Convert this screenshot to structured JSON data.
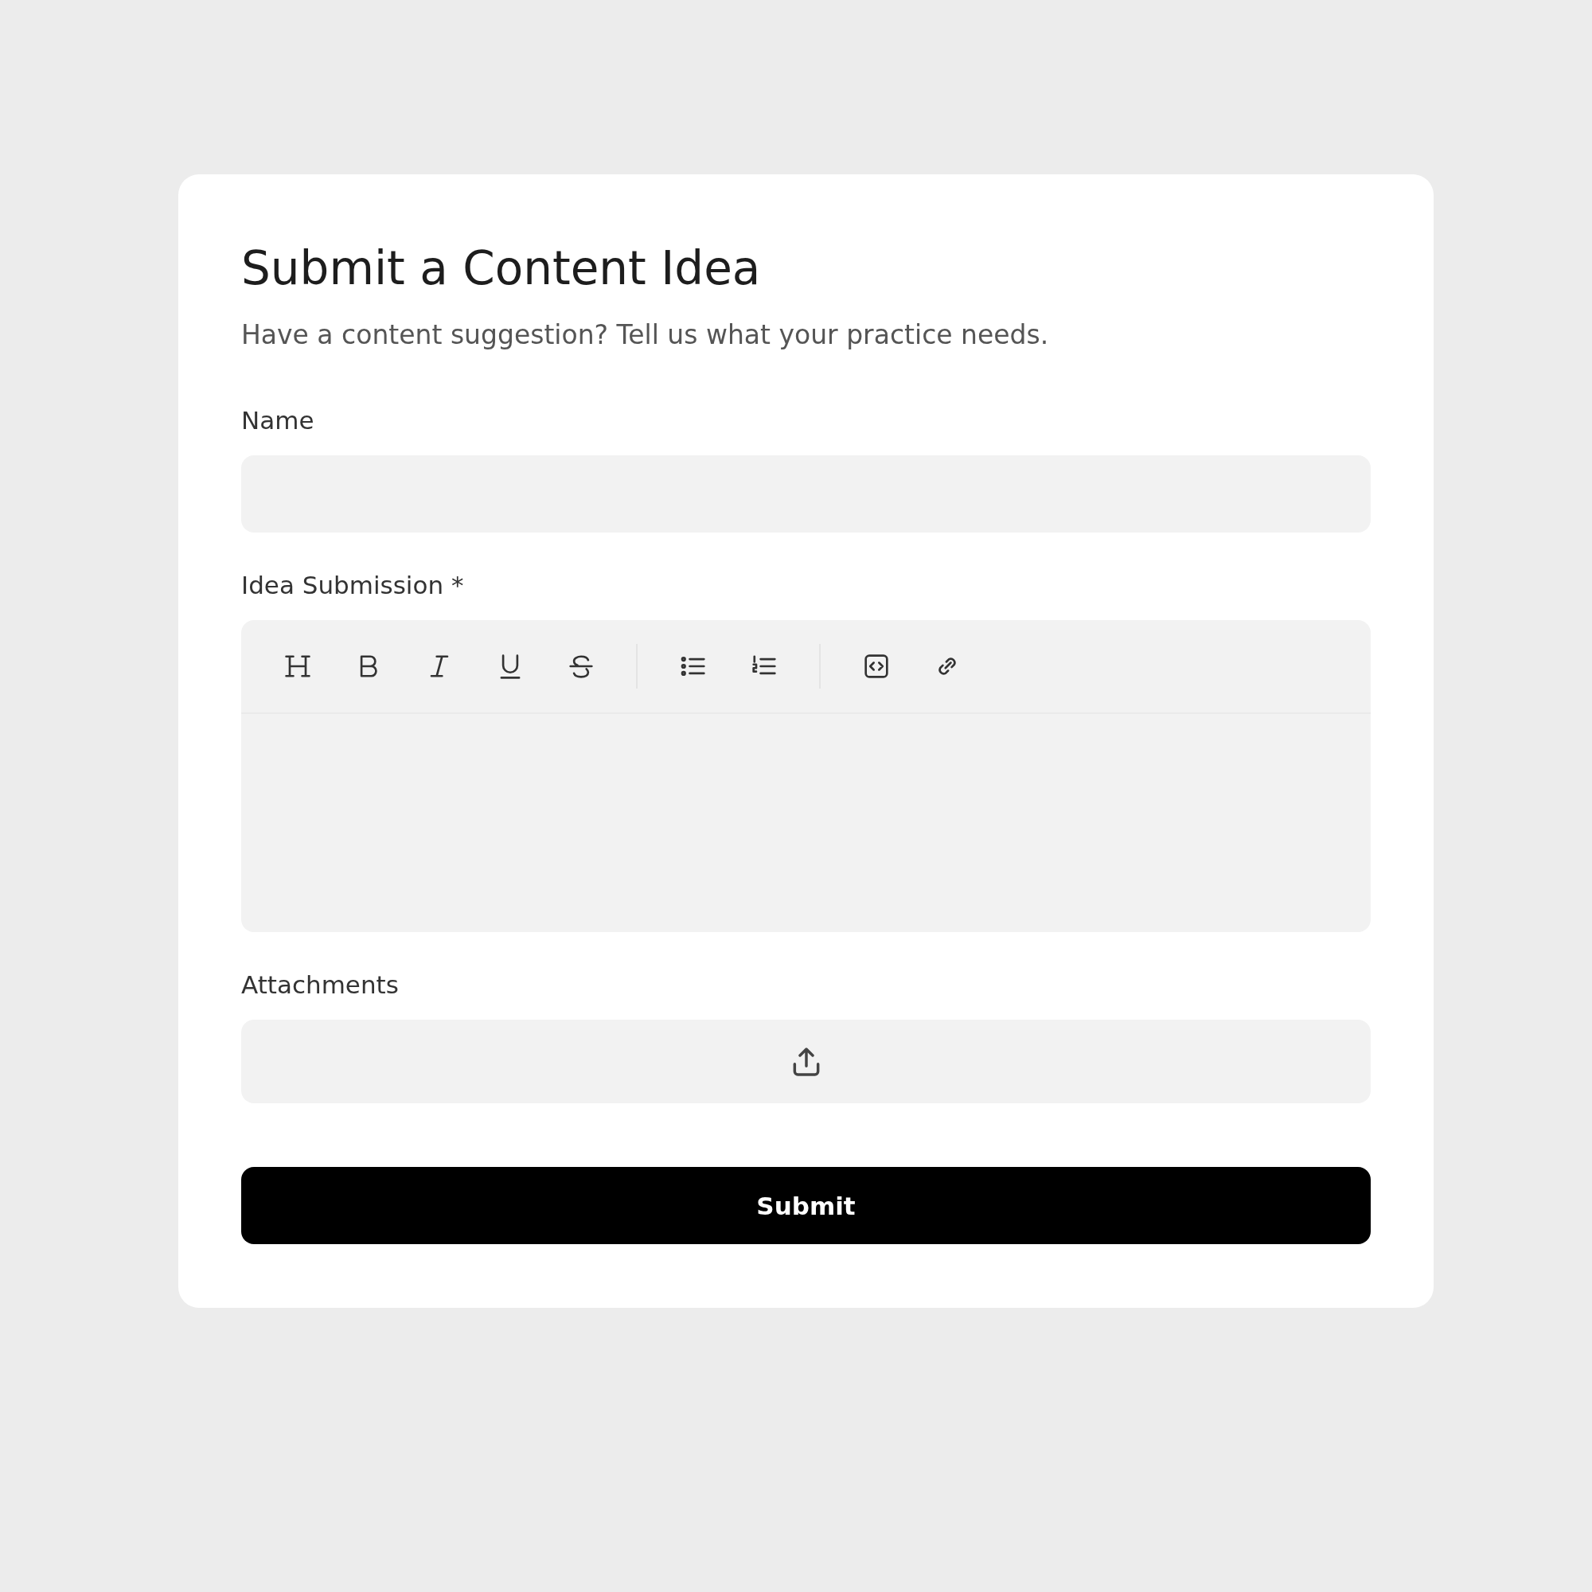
{
  "form": {
    "title": "Submit a Content Idea",
    "subtitle": "Have a content suggestion? Tell us what your practice needs.",
    "fields": [
      {
        "kind": "text",
        "label": "Name"
      },
      {
        "kind": "editor",
        "label": "Idea Submission",
        "required_mark": "*",
        "toolbar_groups": [
          [
            {
              "kind": "heading"
            },
            {
              "kind": "bold"
            },
            {
              "kind": "italic"
            },
            {
              "kind": "underline"
            },
            {
              "kind": "strike"
            }
          ],
          [
            {
              "kind": "bullet-list"
            },
            {
              "kind": "numbered-list"
            }
          ],
          [
            {
              "kind": "code"
            },
            {
              "kind": "link"
            }
          ]
        ]
      },
      {
        "kind": "upload",
        "label": "Attachments"
      }
    ],
    "submit": "Submit"
  }
}
